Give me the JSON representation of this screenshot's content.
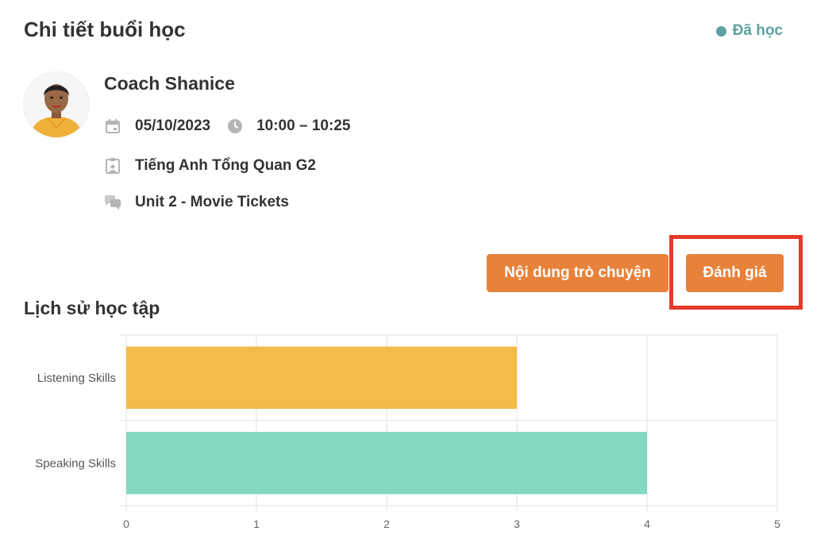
{
  "header": {
    "title": "Chi tiết buổi học",
    "status_label": "Đã học",
    "status_color": "#5aa3a0"
  },
  "session": {
    "coach_name": "Coach Shanice",
    "date": "05/10/2023",
    "time": "10:00 – 10:25",
    "course": "Tiếng Anh Tổng Quan G2",
    "unit": "Unit 2 - Movie Tickets",
    "icons": [
      "calendar-icon",
      "clock-icon",
      "course-board-icon",
      "chat-bubbles-icon"
    ]
  },
  "actions": {
    "chat_label": "Nội dung trò chuyện",
    "rate_label": "Đánh giá",
    "button_color": "#e8823a",
    "highlight_color": "#e53b2c"
  },
  "history": {
    "title": "Lịch sử học tập"
  },
  "chart_data": {
    "type": "bar",
    "orientation": "horizontal",
    "categories": [
      "Listening Skills",
      "Speaking Skills"
    ],
    "values": [
      3,
      4
    ],
    "colors": [
      "#f4bb4a",
      "#82d8c0"
    ],
    "xlim": [
      0,
      5
    ],
    "xticks": [
      0,
      1,
      2,
      3,
      4,
      5
    ],
    "grid": true,
    "title": "",
    "xlabel": "",
    "ylabel": ""
  }
}
